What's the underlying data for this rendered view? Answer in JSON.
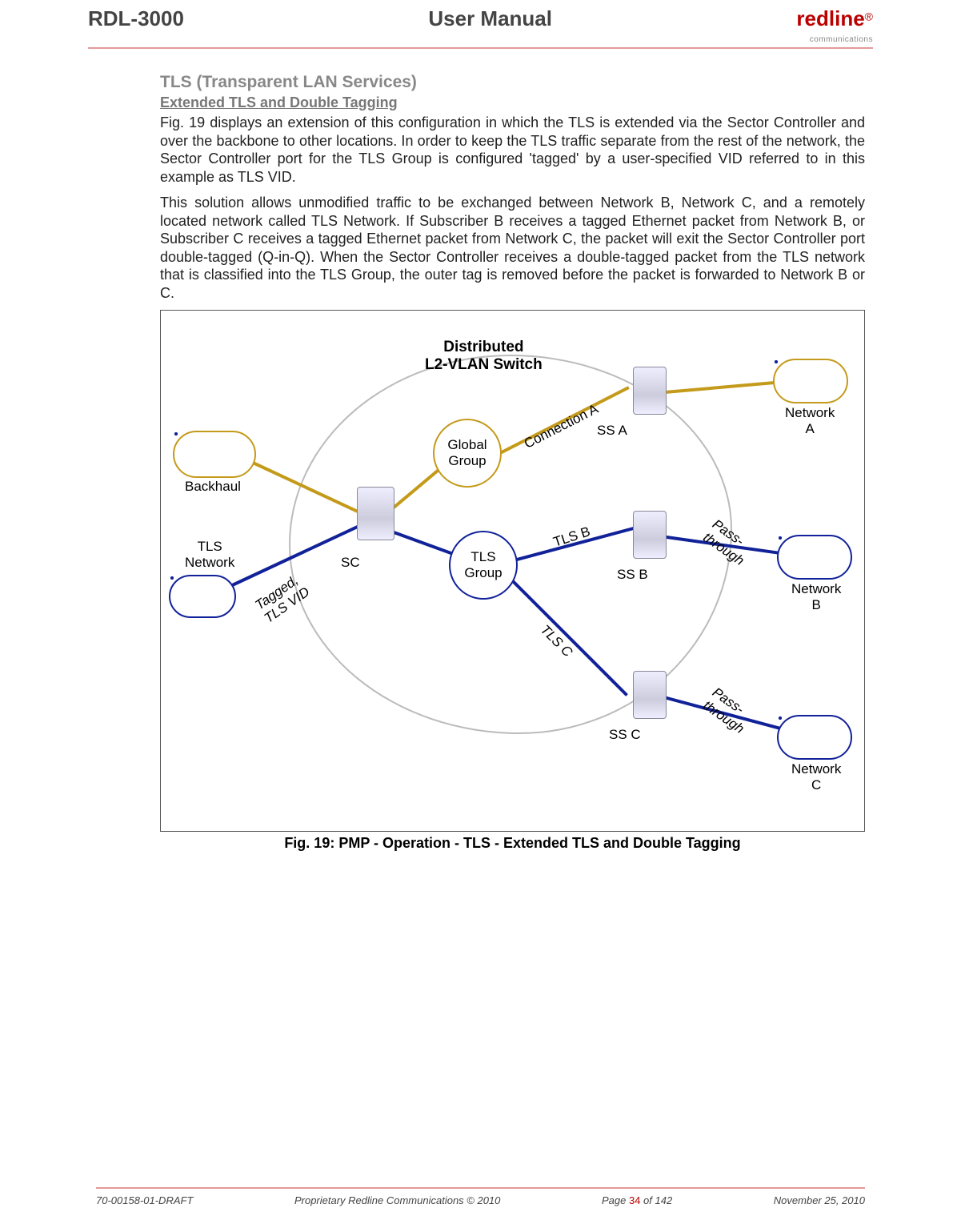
{
  "header": {
    "left": "RDL-3000",
    "center": "User Manual",
    "logo": "redline",
    "logo_sub": "communications"
  },
  "section": {
    "title": "TLS (Transparent LAN Services)",
    "subtitle": "Extended TLS and Double Tagging",
    "para1": "Fig. 19 displays an extension of this configuration in which the TLS is extended via the Sector Controller and over the backbone to other locations. In order to keep the TLS traffic separate from the rest of the network, the Sector Controller port for the TLS Group is configured 'tagged' by a user-specified VID referred to in this example as TLS VID.",
    "para2": "This solution allows unmodified traffic to be exchanged between Network B, Network C, and a remotely located network called TLS Network. If Subscriber B receives a tagged Ethernet packet from Network B, or Subscriber C receives a tagged Ethernet packet from Network C, the packet will exit the Sector Controller port double-tagged (Q-in-Q). When the Sector Controller receives a double-tagged packet from the TLS network that is classified into the TLS Group, the outer tag is removed before the packet is forwarded to Network B or C."
  },
  "diagram": {
    "title_l1": "Distributed",
    "title_l2": "L2-VLAN Switch",
    "backhaul": "Backhaul",
    "tls_network_l1": "TLS",
    "tls_network_l2": "Network",
    "tagged_l1": "Tagged,",
    "tagged_l2": "TLS VID",
    "sc": "SC",
    "global_l1": "Global",
    "global_l2": "Group",
    "tls_group_l1": "TLS",
    "tls_group_l2": "Group",
    "conn_a": "Connection A",
    "tls_b": "TLS B",
    "tls_c": "TLS C",
    "ss_a": "SS A",
    "ss_b": "SS B",
    "ss_c": "SS C",
    "pass_l1": "Pass-",
    "pass_l2": "through",
    "net_a_l1": "Network",
    "net_a_l2": "A",
    "net_b_l1": "Network",
    "net_b_l2": "B",
    "net_c_l1": "Network",
    "net_c_l2": "C"
  },
  "caption": "Fig. 19: PMP - Operation - TLS - Extended TLS and Double Tagging",
  "footer": {
    "doc": "70-00158-01-DRAFT",
    "copyright": "Proprietary Redline Communications © 2010",
    "page_pre": "Page ",
    "page_num": "34",
    "page_post": " of 142",
    "date": "November 25, 2010"
  }
}
